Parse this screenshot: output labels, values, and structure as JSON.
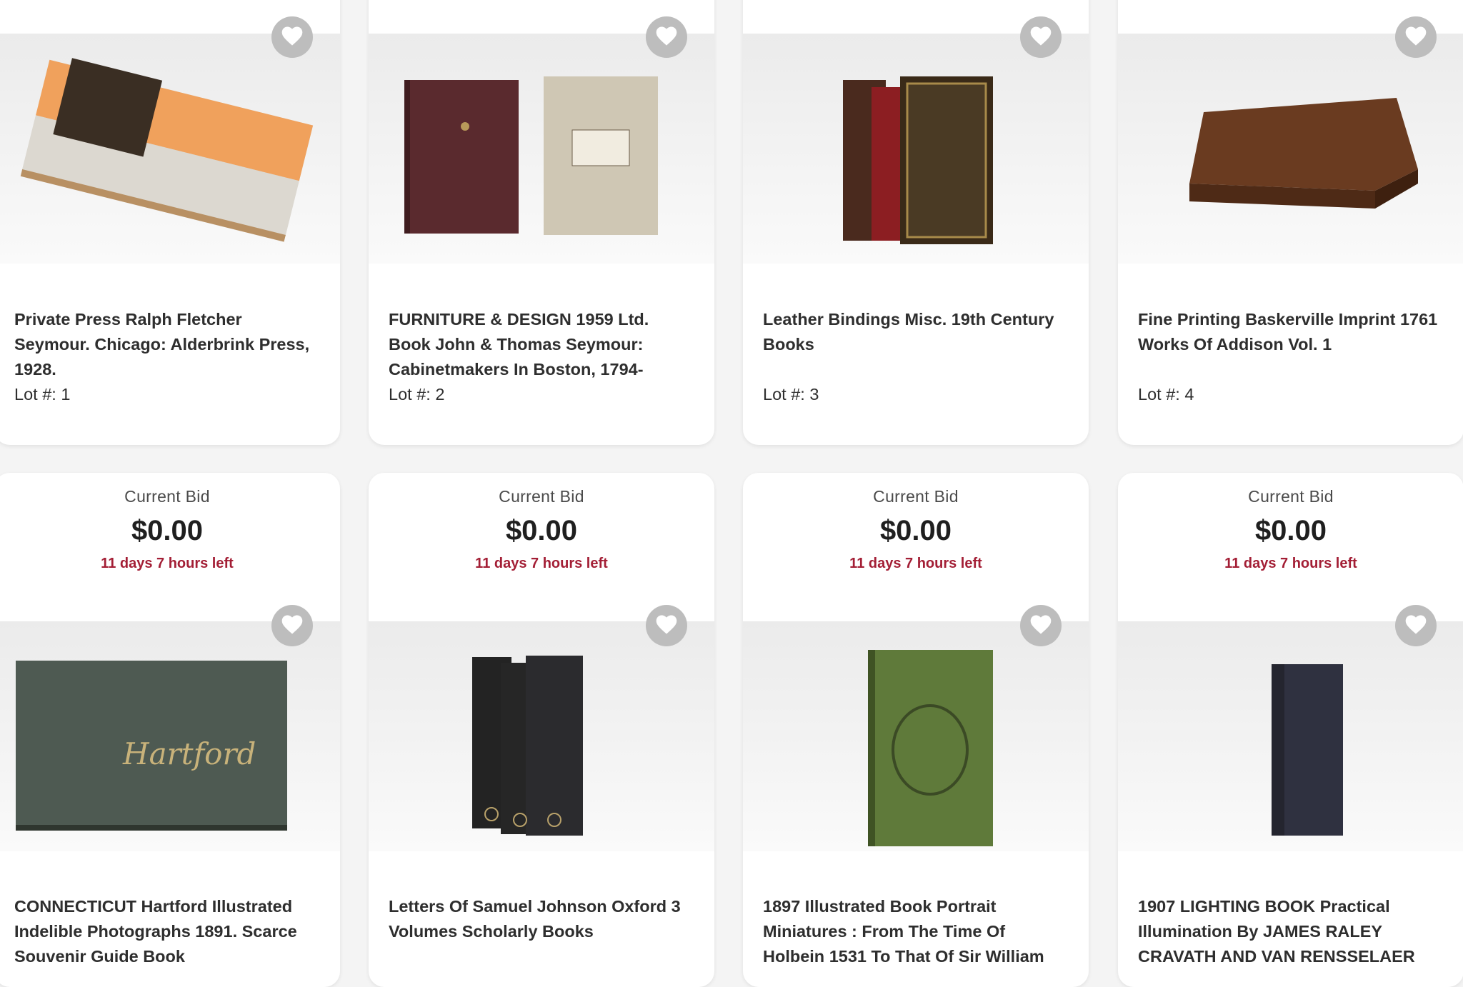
{
  "colors": {
    "accent_time": "#a31e35",
    "favorite_bg": "#bdbdbd",
    "card_bg": "#ffffff"
  },
  "icons": {
    "favorite": "heart-icon"
  },
  "lots": [
    {
      "title": "Private Press Ralph Fletcher Seymour. Chicago: Alderbrink Press, 1928.",
      "lot": "Lot #: 1"
    },
    {
      "title": "FURNITURE & DESIGN 1959 Ltd. Book John & Thomas Seymour: Cabinetmakers In Boston, 1794-",
      "lot": "Lot #: 2"
    },
    {
      "title": "Leather Bindings Misc. 19th Century Books",
      "lot": "Lot #: 3"
    },
    {
      "title": "Fine Printing Baskerville Imprint 1761 Works Of Addison Vol. 1",
      "lot": "Lot #: 4"
    },
    {
      "bid_label": "Current Bid",
      "bid": "$0.00",
      "time_left": "11 days 7 hours left",
      "title": "CONNECTICUT Hartford Illustrated Indelible Photographs 1891. Scarce Souvenir Guide Book"
    },
    {
      "bid_label": "Current Bid",
      "bid": "$0.00",
      "time_left": "11 days 7 hours left",
      "title": "Letters Of Samuel Johnson Oxford 3 Volumes Scholarly Books"
    },
    {
      "bid_label": "Current Bid",
      "bid": "$0.00",
      "time_left": "11 days 7 hours left",
      "title": "1897 Illustrated Book Portrait Miniatures : From The Time Of Holbein 1531 To That Of Sir William"
    },
    {
      "bid_label": "Current Bid",
      "bid": "$0.00",
      "time_left": "11 days 7 hours left",
      "title": "1907 LIGHTING BOOK Practical Illumination By JAMES RALEY CRAVATH AND VAN RENSSELAER"
    }
  ]
}
